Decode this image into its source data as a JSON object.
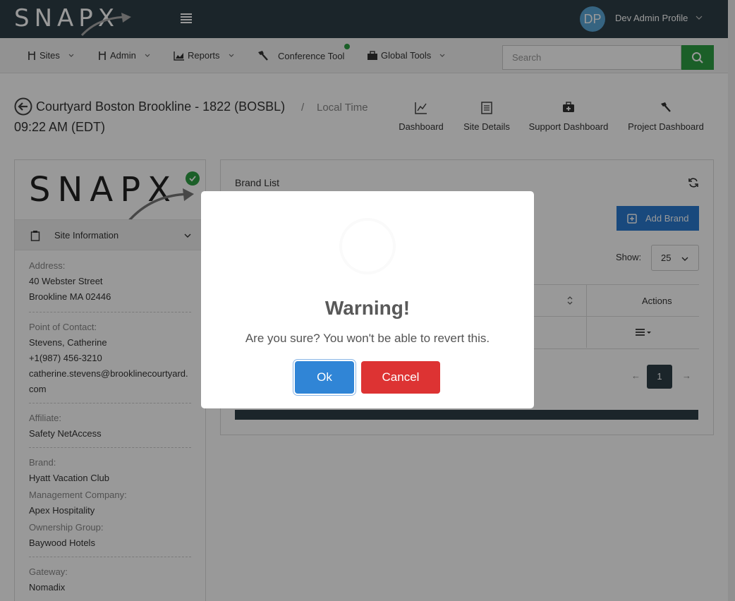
{
  "brand": {
    "logo_text": "SNAPX"
  },
  "profile": {
    "initials": "DP",
    "name": "Dev Admin Profile"
  },
  "nav": {
    "items": [
      {
        "label": "Sites"
      },
      {
        "label": "Admin"
      },
      {
        "label": "Reports"
      },
      {
        "label": "Conference Tool"
      },
      {
        "label": "Global Tools"
      }
    ],
    "search_placeholder": "Search"
  },
  "header": {
    "site_title": "Courtyard Boston Brookline - 1822 (BOSBL)",
    "separator": "/",
    "local_time_label": "Local Time",
    "local_time": "09:22 AM (EDT)",
    "links": [
      {
        "label": "Dashboard"
      },
      {
        "label": "Site Details"
      },
      {
        "label": "Support Dashboard"
      },
      {
        "label": "Project Dashboard"
      }
    ]
  },
  "sidebar": {
    "section_label": "Site Information",
    "address_label": "Address:",
    "address_line1": "40 Webster Street",
    "address_line2": "Brookline MA 02446",
    "contact_label": "Point of Contact:",
    "contact_name": "Stevens, Catherine",
    "contact_phone": "+1(987) 456-3210",
    "contact_email": "catherine.stevens@brooklinecourtyard.com",
    "affiliate_label": "Affiliate:",
    "affiliate": "Safety NetAccess",
    "brand_label": "Brand:",
    "brand": "Hyatt Vacation Club",
    "mgmt_label": "Management Company:",
    "mgmt": "Apex Hospitality",
    "ownership_label": "Ownership Group:",
    "ownership": "Baywood Hotels",
    "gateway_label": "Gateway:",
    "gateway": "Nomadix"
  },
  "main": {
    "title": "Brand List",
    "add_button": "Add Brand",
    "show_label": "Show:",
    "show_value": "25",
    "actions_header": "Actions",
    "pager": {
      "prev": "←",
      "page": "1",
      "next": "→"
    }
  },
  "modal": {
    "title": "Warning!",
    "text": "Are you sure? You won't be able to revert this.",
    "ok": "Ok",
    "cancel": "Cancel"
  },
  "colors": {
    "topbar": "#2d3e46",
    "success": "#2e9e44",
    "primary": "#2b7ad1",
    "ok_button": "#3085d6",
    "cancel_button": "#dd3333"
  }
}
